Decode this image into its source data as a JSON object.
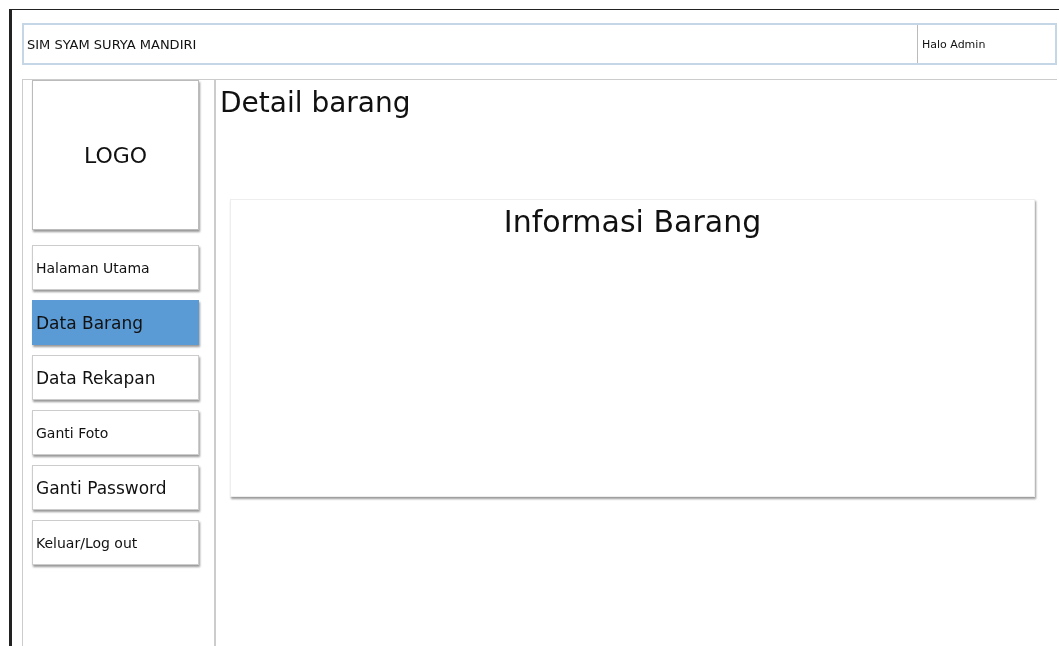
{
  "header": {
    "title": "SIM SYAM SURYA MANDIRI",
    "user_greeting": "Halo Admin"
  },
  "sidebar": {
    "logo": "LOGO",
    "items": [
      {
        "label": "Halaman Utama",
        "selected": false
      },
      {
        "label": "Data Barang",
        "selected": true
      },
      {
        "label": "Data Rekapan",
        "selected": false
      },
      {
        "label": "Ganti Foto",
        "selected": false
      },
      {
        "label": "Ganti Password",
        "selected": false
      },
      {
        "label": "Keluar/Log out",
        "selected": false
      }
    ]
  },
  "page_title": "Detail barang",
  "panel": {
    "title": "Informasi Barang"
  }
}
